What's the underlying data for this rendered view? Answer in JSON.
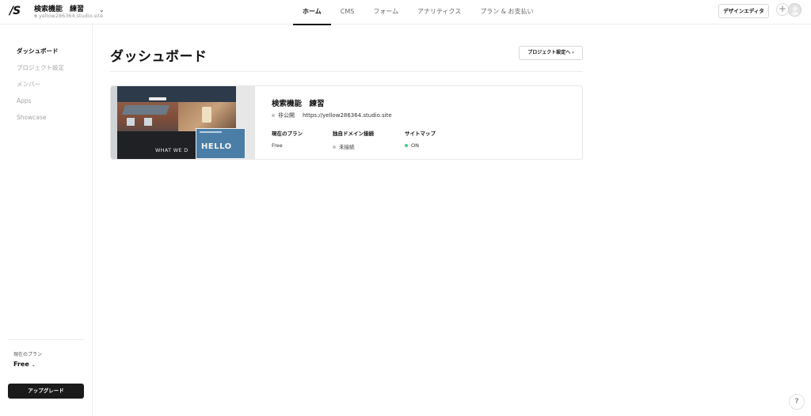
{
  "header": {
    "logo": "/S",
    "project_name": "検索機能　練習",
    "project_domain": "yellow286364.studio.site",
    "tabs": [
      {
        "label": "ホーム",
        "active": true
      },
      {
        "label": "CMS",
        "active": false
      },
      {
        "label": "フォーム",
        "active": false
      },
      {
        "label": "アナリティクス",
        "active": false
      },
      {
        "label": "プラン & お支払い",
        "active": false
      }
    ],
    "design_editor_label": "デザインエディタ",
    "add_label": "+"
  },
  "sidebar": {
    "items": [
      {
        "label": "ダッシュボード",
        "active": true
      },
      {
        "label": "プロジェクト設定",
        "active": false
      },
      {
        "label": "メンバー",
        "active": false
      },
      {
        "label": "Apps",
        "active": false
      },
      {
        "label": "Showcase",
        "active": false
      }
    ],
    "plan_label": "現在のプラン",
    "plan_value": "Free",
    "upgrade_label": "アップグレード"
  },
  "main": {
    "title": "ダッシュボード",
    "settings_button": "プロジェクト設定へ ›",
    "card": {
      "thumbnail_text_1": "WHAT WE D",
      "thumbnail_text_2": "HELLO",
      "title": "検索機能　練習",
      "visibility": "非公開",
      "url": "https://yellow286364.studio.site",
      "plan_label": "現在のプラン",
      "plan_value": "Free",
      "domain_label": "独自ドメイン接続",
      "domain_value": "未接続",
      "sitemap_label": "サイトマップ",
      "sitemap_value": "ON"
    }
  },
  "help_label": "?",
  "colors": {
    "accent": "#111111",
    "status_on": "#3ccf8e",
    "status_off": "#c4c4c4",
    "upgrade_bg": "#1a1a1a"
  }
}
